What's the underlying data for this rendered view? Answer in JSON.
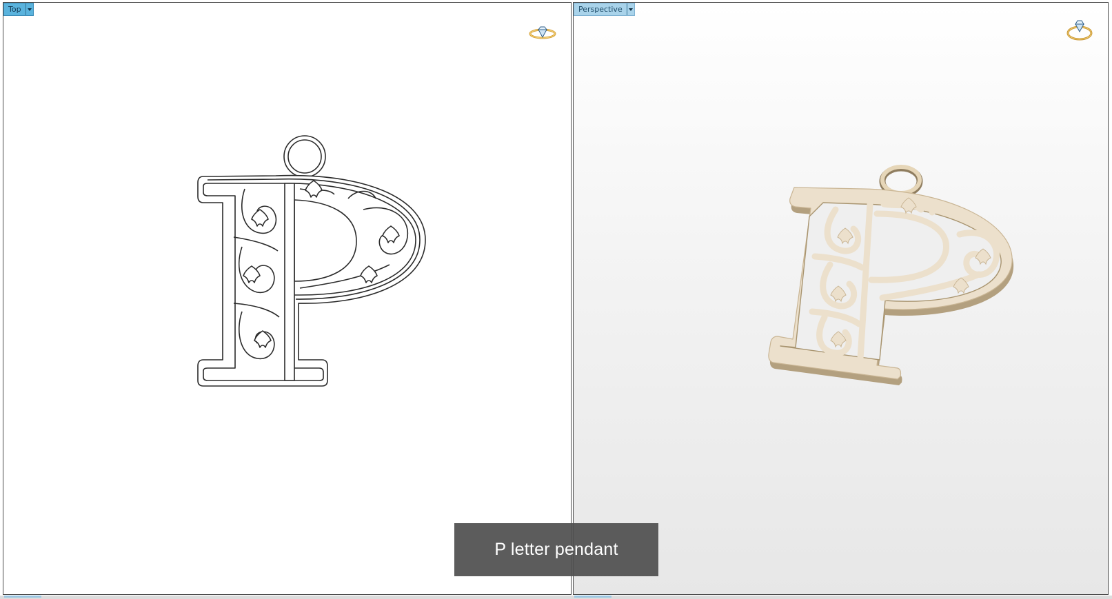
{
  "viewports": {
    "top": {
      "label": "Top",
      "menu_icon": "chevron-down-icon",
      "badge_icon": "ring-diamond-icon",
      "shading": "wireframe"
    },
    "perspective": {
      "label": "Perspective",
      "menu_icon": "chevron-down-icon",
      "badge_icon": "ring-diamond-icon",
      "shading": "rendered"
    }
  },
  "caption": {
    "text": "P letter pendant"
  },
  "colors": {
    "tab_active": "#5ab3dd",
    "tab_inactive": "#a9d3ea",
    "model_gold": "#ece0cc",
    "model_gold_edge": "#b3a07f",
    "caption_bg": "#4e4e4e"
  }
}
